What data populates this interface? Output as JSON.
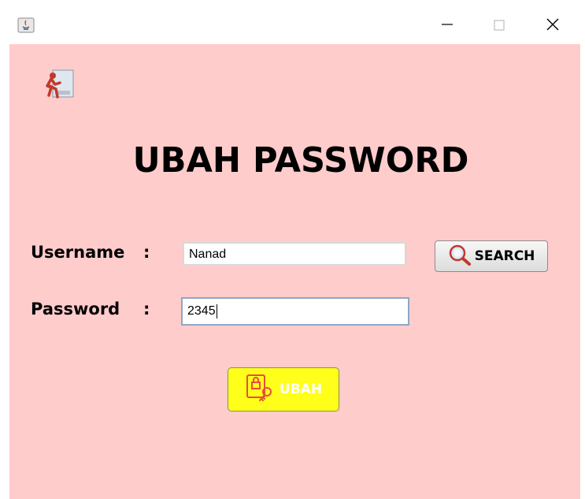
{
  "window": {
    "minimize_icon": "minimize-icon",
    "maximize_icon": "maximize-icon",
    "close_icon": "close-icon"
  },
  "heading": "UBAH PASSWORD",
  "form": {
    "username_label": "Username",
    "password_label": "Password",
    "colon": ":",
    "username_value": "Nanad",
    "password_value": "2345"
  },
  "buttons": {
    "search_label": "SEARCH",
    "ubah_label": "UBAH"
  },
  "colors": {
    "panel_bg": "#ffcccc",
    "ubah_bg": "#ffff1a"
  }
}
